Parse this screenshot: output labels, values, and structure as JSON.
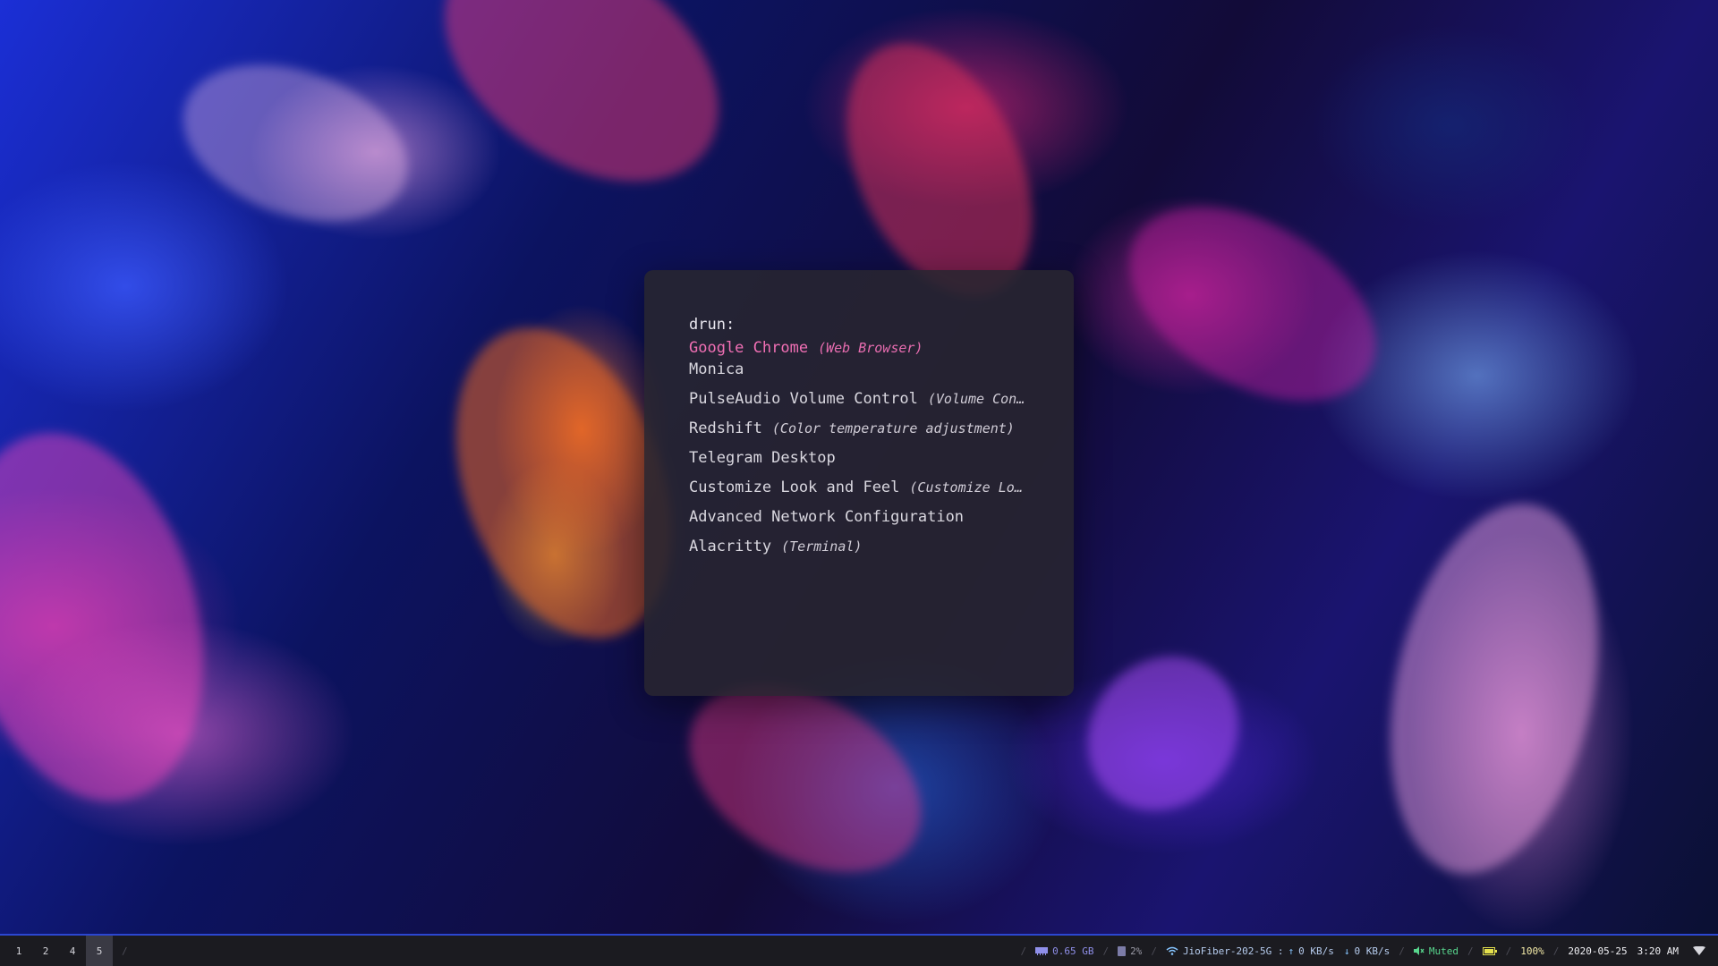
{
  "launcher": {
    "prompt": "drun:",
    "input_value": "",
    "entries": [
      {
        "name": "Google Chrome",
        "generic": "(Web Browser)",
        "selected": true
      },
      {
        "name": "Monica",
        "generic": ""
      },
      {
        "name": "PulseAudio Volume Control",
        "generic": "(Volume Cont…"
      },
      {
        "name": "Redshift",
        "generic": "(Color temperature adjustment)"
      },
      {
        "name": "Telegram Desktop",
        "generic": ""
      },
      {
        "name": "Customize Look and Feel",
        "generic": "(Customize Loo…"
      },
      {
        "name": "Advanced Network Configuration",
        "generic": ""
      },
      {
        "name": "Alacritty",
        "generic": "(Terminal)"
      }
    ],
    "selected_color": "#f06fb4"
  },
  "bar": {
    "workspaces": [
      "1",
      "2",
      "4",
      "5"
    ],
    "active_workspace": "5",
    "divider": "/",
    "ram": {
      "icon": "ram-icon",
      "value": "0.65 GB"
    },
    "cpu": {
      "icon": "cpu-icon",
      "value": "2%"
    },
    "network": {
      "icon": "wifi-icon",
      "ssid": "JioFiber-202-5G :",
      "up": "0 KB/s",
      "down": "0 KB/s"
    },
    "volume": {
      "icon": "speaker-muted-icon",
      "value": "Muted"
    },
    "battery": {
      "icon": "battery-icon",
      "value": "100%"
    },
    "date": "2020-05-25",
    "time": "3:20 AM",
    "tray_icon": "wifi-tray-icon",
    "accent": "#2b46d0"
  }
}
